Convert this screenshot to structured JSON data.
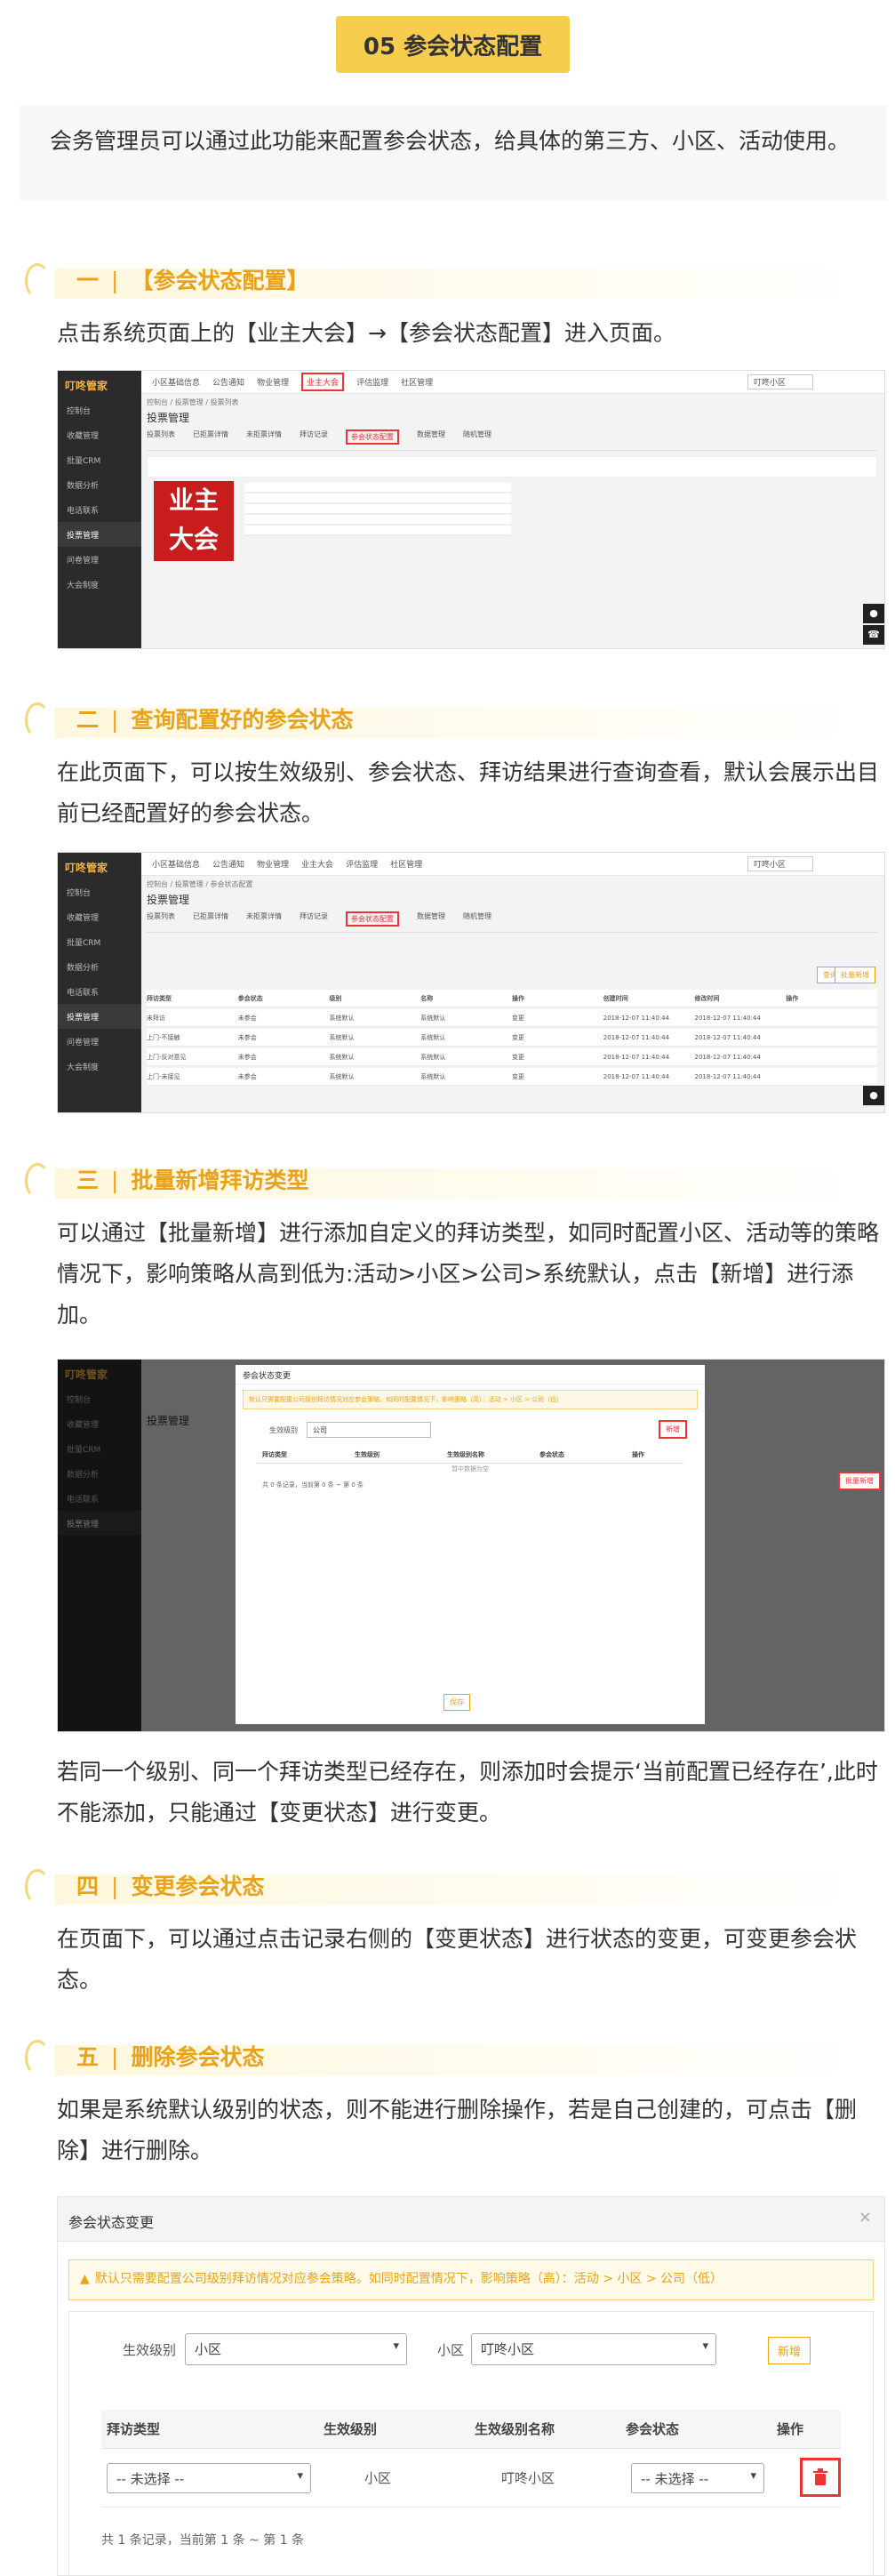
{
  "title": "05 参会状态配置",
  "intro": "会务管理员可以通过此功能来配置参会状态，给具体的第三方、小区、活动使用。",
  "sections": [
    {
      "num": "一",
      "title": "【参会状态配置】",
      "text": "点击系统页面上的【业主大会】→【参会状态配置】进入页面。"
    },
    {
      "num": "二",
      "title": "查询配置好的参会状态",
      "text": "在此页面下，可以按生效级别、参会状态、拜访结果进行查询查看，默认会展示出目前已经配置好的参会状态。"
    },
    {
      "num": "三",
      "title": "批量新增拜访类型",
      "text": "可以通过【批量新增】进行添加自定义的拜访类型，如同时配置小区、活动等的策略情况下，影响策略从高到低为:活动>小区>公司>系统默认，点击【新增】进行添加。",
      "text2": "若同一个级别、同一个拜访类型已经存在，则添加时会提示‘当前配置已经存在’,此时不能添加，只能通过【变更状态】进行变更。"
    },
    {
      "num": "四",
      "title": "变更参会状态",
      "text": "在页面下，可以通过点击记录右侧的【变更状态】进行状态的变更，可变更参会状态。"
    },
    {
      "num": "五",
      "title": "删除参会状态",
      "text": "如果是系统默认级别的状态，则不能进行删除操作，若是自己创建的，可点击【删除】进行删除。"
    }
  ],
  "app": {
    "logo": "叮咚管家",
    "sidebar": [
      "控制台",
      "收藏管理",
      "批量CRM",
      "数据分析",
      "电话联系",
      "投票管理",
      "问卷管理",
      "大会制度"
    ],
    "topnav": [
      "小区基础信息",
      "公告通知",
      "物业管理",
      "业主大会",
      "评估监理",
      "社区管理"
    ],
    "community": "叮咚小区",
    "breadcrumb": "控制台 / 投票管理 / 投票列表",
    "breadcrumb2": "控制台 / 投票管理 / 参会状态配置",
    "page_title": "投票管理",
    "tabs": [
      "投票列表",
      "已拒票详情",
      "未拒票详情",
      "拜访记录",
      "参会状态配置",
      "数据管理",
      "随机管理"
    ],
    "table_headers": [
      "拜访类型",
      "参会状态",
      "级别",
      "名称",
      "操作",
      "创建时间",
      "修改时间",
      "操作"
    ],
    "rows": [
      [
        "未拜访",
        "未参会",
        "系统默认",
        "系统默认",
        "变更",
        "2018-12-07 11:40:44",
        "2018-12-07 11:40:44"
      ],
      [
        "上门-不接触",
        "未参会",
        "系统默认",
        "系统默认",
        "变更",
        "2018-12-07 11:40:44",
        "2018-12-07 11:40:44"
      ],
      [
        "上门-反对意见",
        "未参会",
        "系统默认",
        "系统默认",
        "变更",
        "2018-12-07 11:40:44",
        "2018-12-07 11:40:44"
      ],
      [
        "上门-未接见",
        "未参会",
        "系统默认",
        "系统默认",
        "变更",
        "2018-12-07 11:40:44",
        "2018-12-07 11:40:44"
      ]
    ],
    "btn_query": "查询",
    "btn_batch": "批量新增",
    "modal_title": "参会状态变更",
    "modal_warn": "默认只需要配置公司级别拜访情况对应参会策略。如同时配置情况下，影响策略（高）：活动 > 小区 > 公司（低）",
    "modal_level_label": "生效级别",
    "modal_level_value": "公司",
    "modal_add": "新增",
    "modal_headers": [
      "拜访类型",
      "生效级别",
      "生效级别名称",
      "参会状态",
      "操作"
    ],
    "modal_empty": "暂中数据为空",
    "modal_count": "共 0 条记录，当前第 0 条 ~ 第 0 条",
    "modal_save": "保存"
  },
  "delete_panel": {
    "title": "参会状态变更",
    "warn": "默认只需要配置公司级别拜访情况对应参会策略。如同时配置情况下，影响策略（高）：活动 > 小区 > 公司（低）",
    "level_label": "生效级别",
    "level_value": "小区",
    "community_label": "小区",
    "community_value": "叮咚小区",
    "add": "新增",
    "headers": [
      "拜访类型",
      "生效级别",
      "生效级别名称",
      "参会状态",
      "操作"
    ],
    "row": {
      "type": "-- 未选择 --",
      "level": "小区",
      "name": "叮咚小区",
      "status": "-- 未选择 --"
    },
    "count": "共 1 条记录，当前第 1 条 ~ 第 1 条"
  }
}
